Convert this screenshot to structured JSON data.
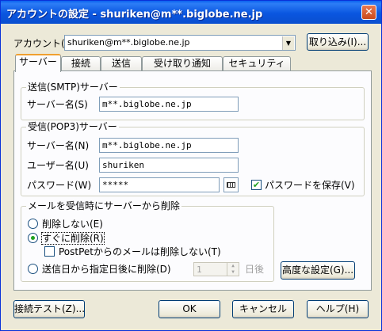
{
  "window": {
    "title": "アカウントの設定 - shuriken@m**.biglobe.ne.jp",
    "close_glyph": "✕"
  },
  "account": {
    "label": "アカウント(L)",
    "value": "shuriken@m**.biglobe.ne.jp",
    "import_button": "取り込み(I)..."
  },
  "tabs": [
    "サーバー",
    "接続",
    "送信",
    "受け取り通知",
    "セキュリティ"
  ],
  "smtp": {
    "group_title": "送信(SMTP)サーバー",
    "server_label": "サーバー名(S)",
    "server_value": "m**.biglobe.ne.jp"
  },
  "pop3": {
    "group_title": "受信(POP3)サーバー",
    "server_label": "サーバー名(N)",
    "server_value": "m**.biglobe.ne.jp",
    "user_label": "ユーザー名(U)",
    "user_value": "shuriken",
    "password_label": "パスワード(W)",
    "password_value": "*****",
    "save_password_label": "パスワードを保存(V)",
    "save_password_checked": true
  },
  "delete_group": {
    "title": "メールを受信時にサーバーから削除",
    "options": [
      "削除しない(E)",
      "すぐに削除(R)",
      "送信日から指定日後に削除(D)"
    ],
    "selected_index": 1,
    "postpet_label": "PostPetからのメールは削除しない(T)",
    "postpet_checked": false,
    "days_value": "1",
    "days_unit": "日後"
  },
  "advanced_button": "高度な設定(G)...",
  "footer": {
    "test_button": "接続テスト(Z)...",
    "ok_button": "OK",
    "cancel_button": "キャンセル",
    "help_button": "ヘルプ(H)"
  },
  "colors": {
    "title_bar": "#0a56e0",
    "dialog_bg": "#ece9d8",
    "panel_bg": "#fcfcfe",
    "radio_dot": "#21a121"
  }
}
